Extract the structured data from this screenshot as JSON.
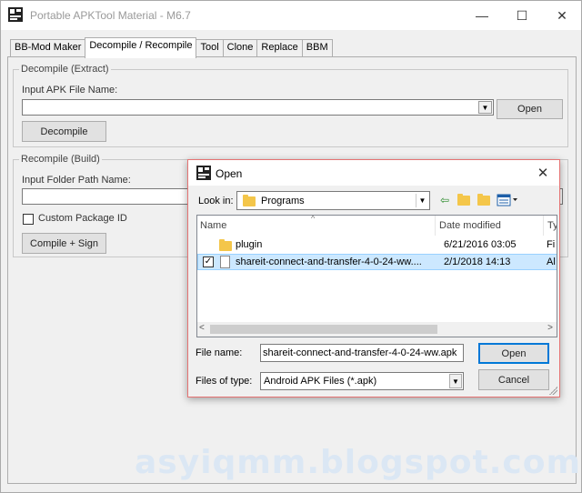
{
  "window": {
    "title": "Portable APKTool Material - M6.7",
    "minimize_glyph": "—",
    "maximize_glyph": "☐",
    "close_glyph": "✕"
  },
  "tabs": [
    "BB-Mod Maker",
    "Decompile / Recompile",
    "Tool",
    "Clone",
    "Replace",
    "BBM"
  ],
  "decompile": {
    "legend": "Decompile (Extract)",
    "input_label": "Input APK File Name:",
    "input_value": "",
    "open_button": "Open",
    "decompile_button": "Decompile"
  },
  "recompile": {
    "legend": "Recompile (Build)",
    "input_label": "Input Folder Path Name:",
    "input_value": "",
    "custom_package_label": "Custom Package ID",
    "compile_button": "Compile + Sign"
  },
  "open_dialog": {
    "title": "Open",
    "close_glyph": "✕",
    "look_in_label": "Look in:",
    "look_in_value": "Programs",
    "columns": {
      "name": "Name",
      "date": "Date modified",
      "type": "Ty"
    },
    "rows": [
      {
        "name": "plugin",
        "date": "6/21/2016 03:05",
        "type": "Fi",
        "selected": false
      },
      {
        "name": "shareit-connect-and-transfer-4-0-24-ww....",
        "date": "2/1/2018 14:13",
        "type": "Al",
        "selected": true
      }
    ],
    "file_name_label": "File name:",
    "file_name_value": "shareit-connect-and-transfer-4-0-24-ww.apk",
    "files_of_type_label": "Files of type:",
    "files_of_type_value": "Android APK Files (*.apk)",
    "open_button": "Open",
    "cancel_button": "Cancel"
  },
  "watermark": "asyiqmm.blogspot.com"
}
